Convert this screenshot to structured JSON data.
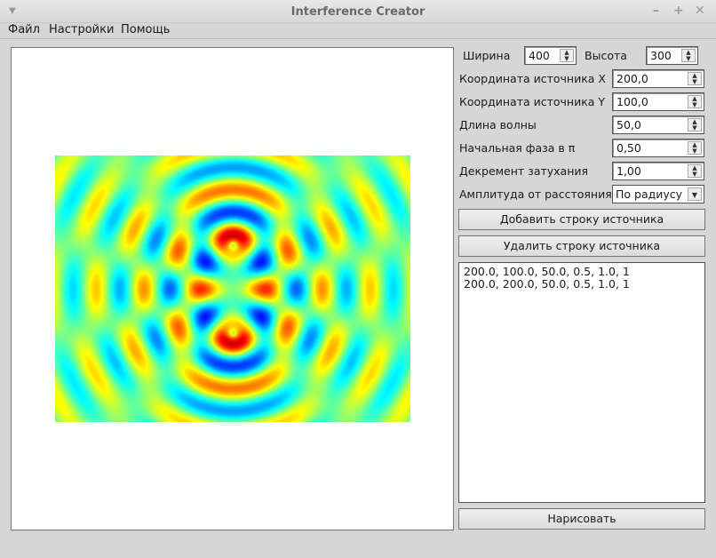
{
  "window": {
    "title": "Interference Creator",
    "menu_icon": "triangle-down-icon",
    "minimize": "–",
    "maximize": "+",
    "close": "✕"
  },
  "menu": [
    "Файл",
    "Настройки",
    "Помощь"
  ],
  "image": {
    "width": 400,
    "height": 300,
    "sources": [
      {
        "x": 200.0,
        "y": 100.0,
        "wavelength": 50.0,
        "phase": 0.5,
        "decrement": 1.0,
        "mode": 1
      },
      {
        "x": 200.0,
        "y": 200.0,
        "wavelength": 50.0,
        "phase": 0.5,
        "decrement": 1.0,
        "mode": 1
      }
    ]
  },
  "controls": {
    "width_label": "Ширина",
    "width_value": "400",
    "height_label": "Высота",
    "height_value": "300",
    "src_x_label": "Координата источника X",
    "src_x_value": "200,0",
    "src_y_label": "Координата источника Y",
    "src_y_value": "100,0",
    "wavelength_label": "Длина волны",
    "wavelength_value": "50,0",
    "phase_label": "Начальная фаза в π",
    "phase_value": "0,50",
    "decrement_label": "Декремент затухания",
    "decrement_value": "1,00",
    "amplitude_label": "Амплитуда от расстояния",
    "amplitude_value": "По радиусу"
  },
  "buttons": {
    "add": "Добавить строку источника",
    "remove": "Удалить строку источника",
    "draw": "Нарисовать"
  },
  "source_lines": [
    "200.0, 100.0, 50.0, 0.5, 1.0, 1",
    "200.0, 200.0, 50.0, 0.5, 1.0, 1"
  ]
}
